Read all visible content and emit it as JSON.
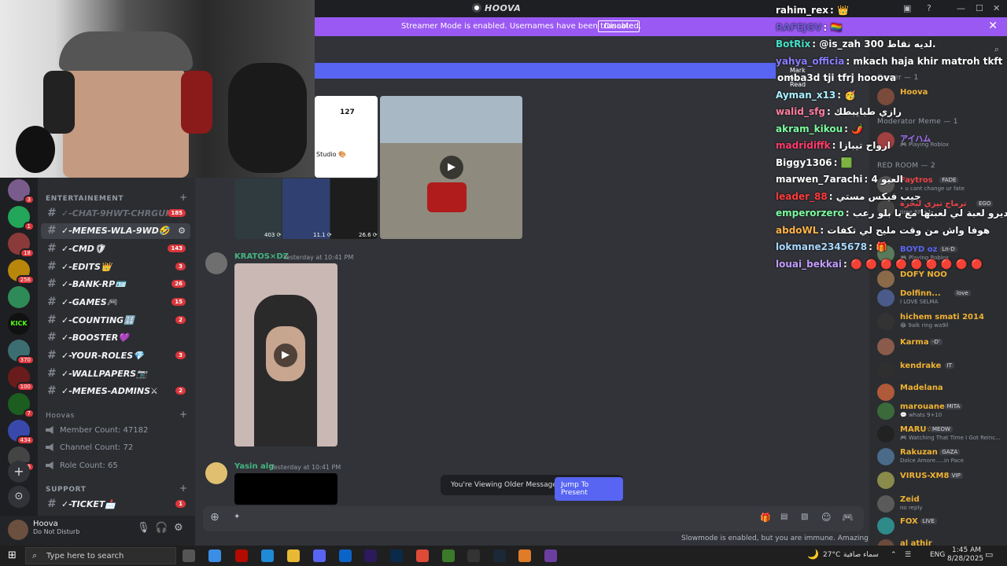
{
  "app": {
    "title": "HOOVA"
  },
  "banner": {
    "text": "Streamer Mode is enabled. Usernames have been truncated.",
    "button": "Disable"
  },
  "server_badges": [
    "3",
    "1",
    "18",
    "256",
    "370",
    "100",
    "7",
    "434",
    "736"
  ],
  "channels": {
    "cat1": "ENTERTAINEMENT",
    "items": [
      {
        "name": "✓-CHAT-9HWT-CHRGUI",
        "count": "185"
      },
      {
        "name": "✓-MEMES-WLA-9WD🤣",
        "count": ""
      },
      {
        "name": "✓-CMD🛡",
        "count": "143"
      },
      {
        "name": "✓-EDITS👑",
        "count": "3"
      },
      {
        "name": "✓-BANK-RP🪪",
        "count": "26"
      },
      {
        "name": "✓-GAMES🎮",
        "count": "15"
      },
      {
        "name": "✓-COUNTING🔢",
        "count": "2"
      },
      {
        "name": "✓-BOOSTER💜",
        "count": ""
      },
      {
        "name": "✓-YOUR-ROLES💎",
        "count": "3"
      },
      {
        "name": "✓-WALLPAPERS📷",
        "count": ""
      },
      {
        "name": "✓-MEMES-ADMINS⚔",
        "count": "2"
      }
    ],
    "cat2": "Hoovas",
    "stats": [
      "Member Count: 47182",
      "Channel Count: 72",
      "Role Count: 65"
    ],
    "cat3": "SUPPORT",
    "ticket": {
      "name": "✓-TICKET📩",
      "count": "1"
    }
  },
  "user": {
    "name": "Hoova",
    "status": "Do Not Disturb"
  },
  "messages": [
    {
      "author": "KRATOS×DZ",
      "time": "Yesterday at 10:41 PM",
      "color": "#43b581"
    },
    {
      "author": "Yasin alg",
      "time": "Yesterday at 10:41 PM",
      "color": "#43b581"
    }
  ],
  "media": {
    "likes": "127",
    "studio": "Studio 🎨",
    "thumb1": "403 ⟳",
    "thumb2": "11.1 ⟳",
    "thumb3": "26.6 ⟳"
  },
  "newbar": {
    "label": "Mark As Read"
  },
  "older": {
    "text": "You're Viewing Older Messages",
    "button": "Jump To Present"
  },
  "slowmode": "Slowmode is enabled, but you are immune. Amazing!",
  "members": {
    "owner_head": "Owner — 1",
    "mod_head": "Moderator Meme — 1",
    "red_head": "RED ROOM — 2",
    "list": [
      {
        "name": "Hoova",
        "sub": "",
        "tag": "",
        "color": "#f0b232"
      },
      {
        "name": "アイハム",
        "sub": "🎮 Playing Roblox",
        "tag": "",
        "color": "#a970ff"
      },
      {
        "name": "Faytros",
        "sub": "• u cant change ur fate",
        "tag": "FADE",
        "color": "#ed4245"
      },
      {
        "name": "ترماح تيزي لبحرة",
        "sub": "time RP +1",
        "tag": "EGO",
        "color": "#ed4245"
      },
      {
        "name": "BOYD oz",
        "sub": "🎮 Playing Roblox",
        "tag": "Ln-D",
        "color": "#5865f2"
      },
      {
        "name": "DOFY NOO",
        "sub": "",
        "tag": "",
        "color": "#f0b232"
      },
      {
        "name": "Dolfinn...",
        "sub": "I LOVE SELMA",
        "tag": "love",
        "color": "#f0b232"
      },
      {
        "name": "hichem smati 2014",
        "sub": "😂 9alk ring wa9il",
        "tag": "",
        "color": "#f0b232"
      },
      {
        "name": "Karma",
        "sub": "",
        "tag": "-D'",
        "color": "#f0b232"
      },
      {
        "name": "kendrake",
        "sub": "",
        "tag": "IT",
        "color": "#f0b232"
      },
      {
        "name": "Madelana",
        "sub": "",
        "tag": "",
        "color": "#f0b232"
      },
      {
        "name": "marouane",
        "sub": "💬 whats 9+10",
        "tag": "MITA",
        "color": "#f0b232"
      },
      {
        "name": "MARU☆",
        "sub": "🎮 Watching That Time I Got Reinc...",
        "tag": "MEOW",
        "color": "#f0b232"
      },
      {
        "name": "Rakuzan",
        "sub": "Dolce Amore.....in Pace",
        "tag": "GAZA",
        "color": "#f0b232"
      },
      {
        "name": "VIRUS-XM8",
        "sub": "",
        "tag": "VIP",
        "color": "#f0b232"
      },
      {
        "name": "Zeid",
        "sub": "no reply",
        "tag": "",
        "color": "#f0b232"
      },
      {
        "name": "FOX",
        "sub": "",
        "tag": "LIVE",
        "color": "#f0b232"
      },
      {
        "name": "al athir",
        "sub": "",
        "tag": "",
        "color": "#f0b232"
      }
    ]
  },
  "chat": [
    {
      "user": "rahim_rex",
      "msg": ": 👑",
      "color": "#ffffff"
    },
    {
      "user": "RAFEJGV",
      "msg": ": 🏳️‍🌈",
      "color": "#6a5acd"
    },
    {
      "user": "BotRix",
      "msg": ": @is_zah 300 لديه نقاط.",
      "color": "#43e2c7"
    },
    {
      "user": "yahya_officia",
      "msg": ": mkach haja khir matroh tkft",
      "color": "#8a7dff"
    },
    {
      "user": "",
      "msg": "omba3d tji tfrj hooova",
      "color": "#ffffff"
    },
    {
      "user": "Ayman_x13",
      "msg": ": 🥳",
      "color": "#a8f0ff"
    },
    {
      "user": "walid_sfg",
      "msg": ": رازي طبايبطك",
      "color": "#ff7fa0"
    },
    {
      "user": "akram_kikou",
      "msg": ": 🌶️",
      "color": "#7cfc9f"
    },
    {
      "user": "madridiffk",
      "msg": ": ارواح تيبازا",
      "color": "#ff3b6b"
    },
    {
      "user": "Biggy1306",
      "msg": ": 🟩",
      "color": "#ffffff"
    },
    {
      "user": "marwen_7arachi",
      "msg": ": العبو 4",
      "color": "#ffffff"
    },
    {
      "user": "leader_88",
      "msg": ": جيب فيكس مستي",
      "color": "#ff3b3b"
    },
    {
      "user": "emperorzero",
      "msg": ": ديرو لعبة لي لعبتها مع با بلو رعب",
      "color": "#7cfc9f"
    },
    {
      "user": "abdoWL",
      "msg": ": هوفا واش من وقت مليح لي تكفات",
      "color": "#ffb347"
    },
    {
      "user": "lokmane2345678",
      "msg": ": 🎁",
      "color": "#a8d8ff"
    },
    {
      "user": "louai_bekkai",
      "msg": ": 🔴 🔴 🔴 🔴 🔴 🔴 🔴 🔴 🔴",
      "color": "#c39bff"
    }
  ],
  "taskbar": {
    "search": "Type here to search",
    "temp": "27°C",
    "weather": "سماء صافية",
    "lang": "ENG",
    "time": "1:45 AM",
    "date": "8/28/2025"
  }
}
